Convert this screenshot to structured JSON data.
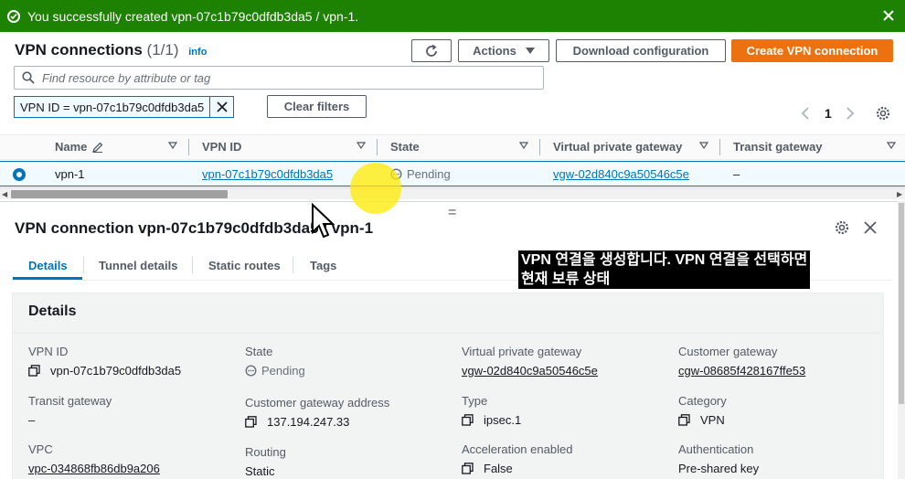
{
  "flash": {
    "message": "You successfully created vpn-07c1b79c0dfdb3da5 / vpn-1."
  },
  "header": {
    "title": "VPN connections",
    "count": "(1/1)",
    "info": "info",
    "actions_label": "Actions",
    "download_label": "Download configuration",
    "create_label": "Create VPN connection"
  },
  "search": {
    "placeholder": "Find resource by attribute or tag"
  },
  "filter": {
    "token": "VPN ID = vpn-07c1b79c0dfdb3da5",
    "clear_label": "Clear filters"
  },
  "pagination": {
    "page": "1"
  },
  "table": {
    "columns": [
      "Name",
      "VPN ID",
      "State",
      "Virtual private gateway",
      "Transit gateway"
    ],
    "row": {
      "name": "vpn-1",
      "vpn_id": "vpn-07c1b79c0dfdb3da5",
      "state": "Pending",
      "vgw": "vgw-02d840c9a50546c5e",
      "transit": "–"
    }
  },
  "panel": {
    "title": "VPN connection vpn-07c1b79c0dfdb3da5 / vpn-1",
    "tabs": [
      "Details",
      "Tunnel details",
      "Static routes",
      "Tags"
    ],
    "section": "Details",
    "fields": {
      "vpn_id": {
        "label": "VPN ID",
        "value": "vpn-07c1b79c0dfdb3da5"
      },
      "state": {
        "label": "State",
        "value": "Pending"
      },
      "vgw": {
        "label": "Virtual private gateway",
        "value": "vgw-02d840c9a50546c5e"
      },
      "cgw": {
        "label": "Customer gateway",
        "value": "cgw-08685f428167ffe53"
      },
      "transit": {
        "label": "Transit gateway",
        "value": "–"
      },
      "cgw_addr": {
        "label": "Customer gateway address",
        "value": "137.194.247.33"
      },
      "type": {
        "label": "Type",
        "value": "ipsec.1"
      },
      "category": {
        "label": "Category",
        "value": "VPN"
      },
      "vpc": {
        "label": "VPC",
        "value": "vpc-034868fb86db9a206"
      },
      "routing": {
        "label": "Routing",
        "value": "Static"
      },
      "accel": {
        "label": "Acceleration enabled",
        "value": "False"
      },
      "auth": {
        "label": "Authentication",
        "value": "Pre-shared key"
      }
    }
  },
  "subtitle": {
    "line1": "VPN 연결을 생성합니다. VPN 연결을 선택하면",
    "line2": "현재 보류 상태"
  },
  "colors": {
    "success": "#1d8102",
    "primary": "#ec7211",
    "link": "#0073bb"
  }
}
